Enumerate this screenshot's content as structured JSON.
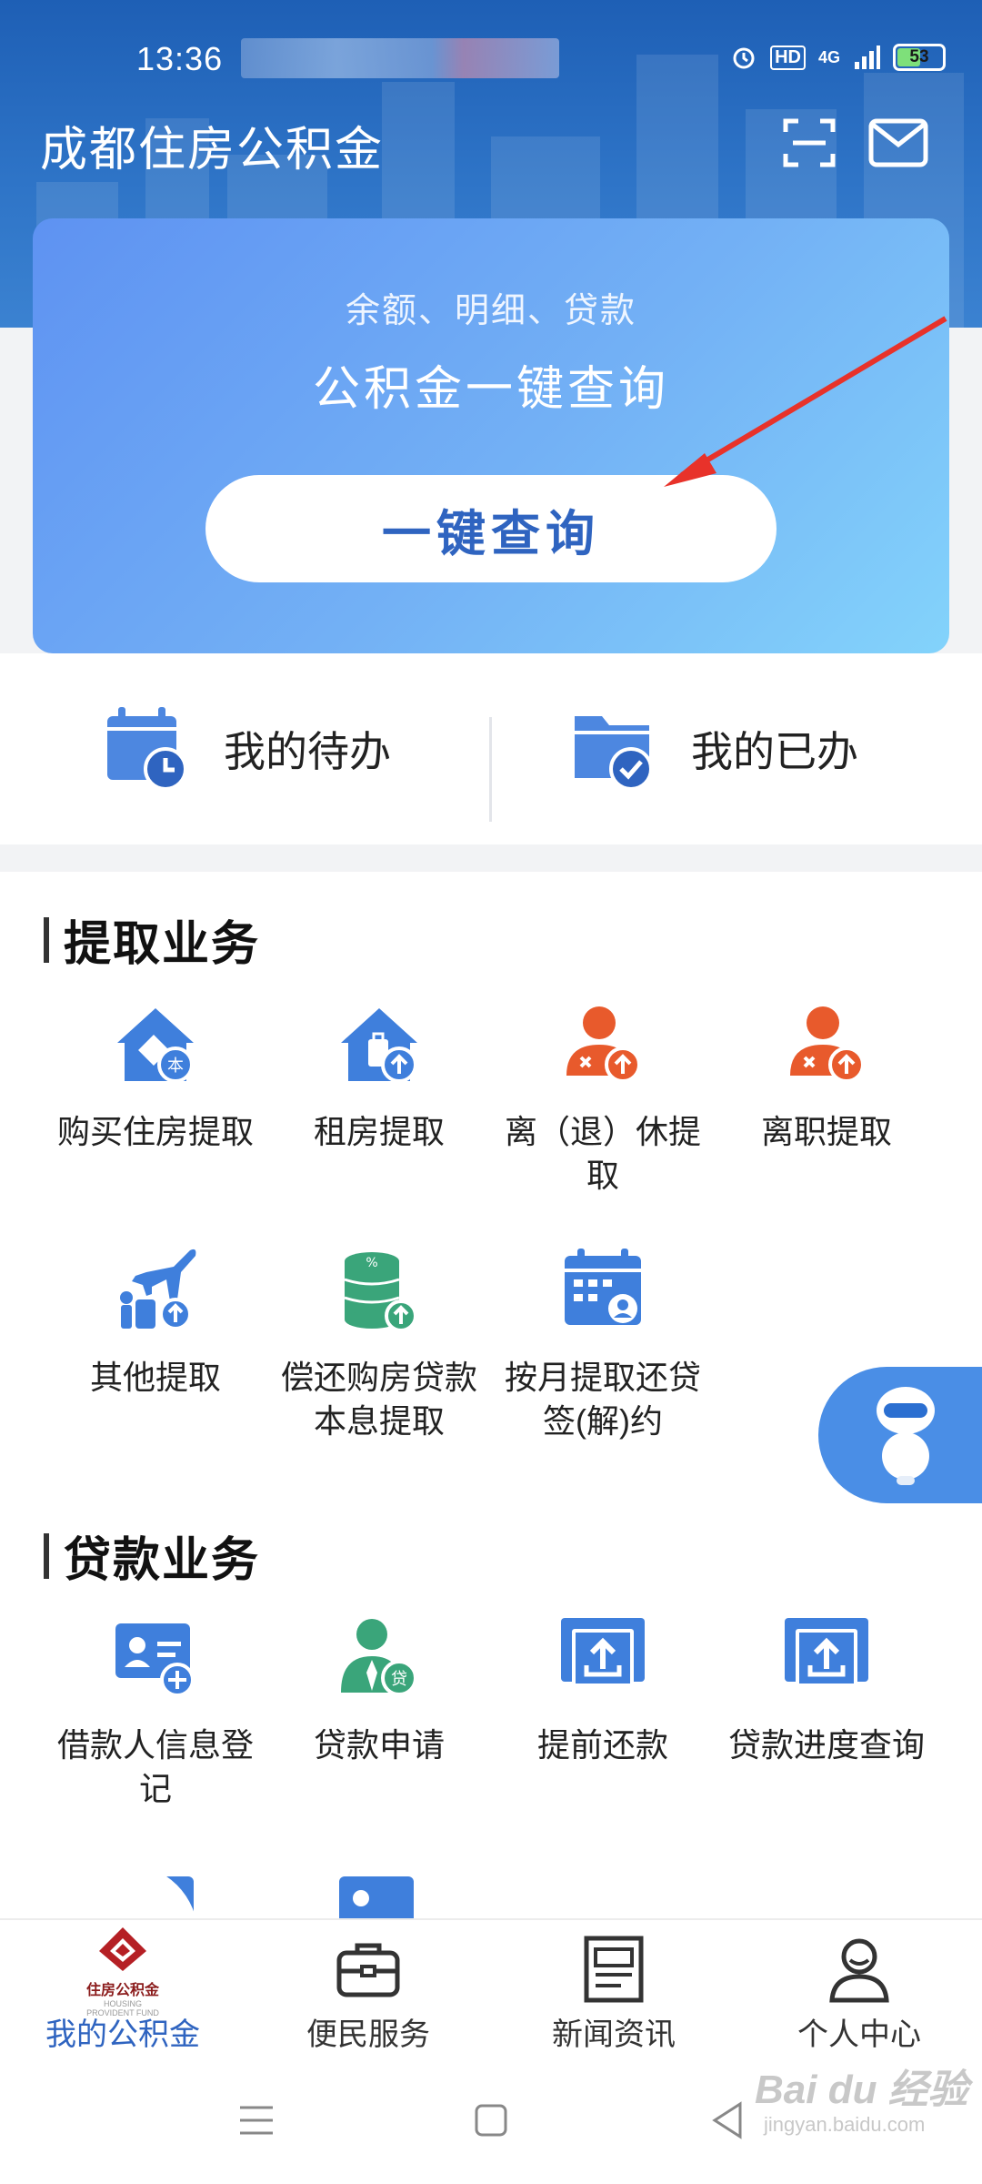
{
  "status_bar": {
    "time": "13:36",
    "network": "4G",
    "hd": "HD",
    "battery": "53"
  },
  "header": {
    "title": "成都住房公积金",
    "scan_icon": "scan-icon",
    "mail_icon": "mail-icon"
  },
  "query_card": {
    "subtitle": "余额、明细、贷款",
    "title": "公积金一键查询",
    "button_label": "一键查询"
  },
  "todo": [
    {
      "label": "我的待办",
      "icon": "calendar-clock-icon"
    },
    {
      "label": "我的已办",
      "icon": "folder-check-icon"
    }
  ],
  "sections": {
    "withdraw": {
      "title": "提取业务",
      "items": [
        {
          "label": "购买住房提取",
          "icon": "house-document-icon"
        },
        {
          "label": "租房提取",
          "icon": "house-luggage-icon"
        },
        {
          "label": "离（退）休提取",
          "icon": "person-retire-icon"
        },
        {
          "label": "离职提取",
          "icon": "person-resign-icon"
        },
        {
          "label": "其他提取",
          "icon": "travel-icon"
        },
        {
          "label": "偿还购房贷款本息提取",
          "icon": "coins-icon"
        },
        {
          "label": "按月提取还贷签(解)约",
          "icon": "calendar-sign-icon"
        }
      ]
    },
    "loan": {
      "title": "贷款业务",
      "items": [
        {
          "label": "借款人信息登记",
          "icon": "id-card-add-icon"
        },
        {
          "label": "贷款申请",
          "icon": "person-loan-icon"
        },
        {
          "label": "提前还款",
          "icon": "upload-tray-icon"
        },
        {
          "label": "贷款进度查询",
          "icon": "upload-tray-icon"
        }
      ]
    }
  },
  "bottom_nav": [
    {
      "label": "我的公积金",
      "active": true,
      "icon": "fund-logo-icon"
    },
    {
      "label": "便民服务",
      "active": false,
      "icon": "briefcase-icon"
    },
    {
      "label": "新闻资讯",
      "active": false,
      "icon": "news-icon"
    },
    {
      "label": "个人中心",
      "active": false,
      "icon": "user-icon"
    }
  ],
  "logo": {
    "name": "住房公积金",
    "sub": "HOUSING PROVIDENT FUND"
  },
  "watermark": {
    "brand": "Bai du 经验",
    "url": "jingyan.baidu.com"
  },
  "colors": {
    "primary": "#2f64c0",
    "accent_orange": "#e85a2c",
    "accent_green": "#3aa57a",
    "header_blue": "#2e74c7"
  }
}
